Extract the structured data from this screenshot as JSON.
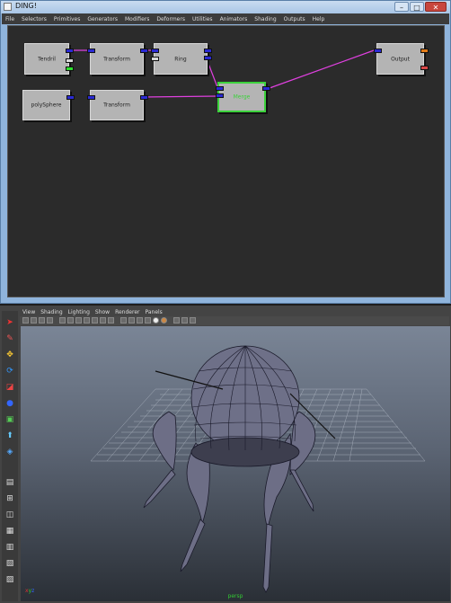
{
  "window": {
    "title": "DING!",
    "buttons": {
      "minimize": "–",
      "maximize": "□",
      "close": "✕"
    }
  },
  "menu": [
    "File",
    "Selectors",
    "Primitives",
    "Generators",
    "Modifiers",
    "Deformers",
    "Utilities",
    "Animators",
    "Shading",
    "Outputs",
    "Help"
  ],
  "nodes": {
    "tendril": "Tendril",
    "transform1": "Transform",
    "ring": "Ring",
    "output": "Output",
    "polysphere": "polySphere",
    "transform2": "Transform",
    "merge": "Merge"
  },
  "viewport": {
    "menu": [
      "View",
      "Shading",
      "Lighting",
      "Show",
      "Renderer",
      "Panels"
    ],
    "camera_label": "persp"
  },
  "colors": {
    "wire": "#e040e0",
    "port_in": "#2a2ad2",
    "selected": "#3cd23c",
    "node_bg": "#b4b4b4",
    "canvas_bg": "#2b2b2b"
  }
}
